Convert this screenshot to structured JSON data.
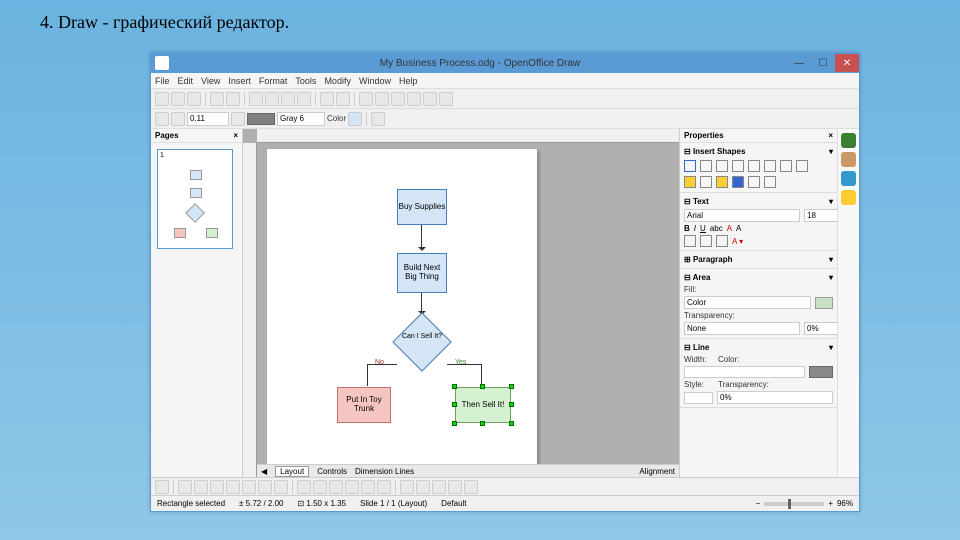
{
  "caption": "4. Draw - графический редактор.",
  "window": {
    "title": "My Business Process.odg - OpenOffice Draw"
  },
  "menu": [
    "File",
    "Edit",
    "View",
    "Insert",
    "Format",
    "Tools",
    "Modify",
    "Window",
    "Help"
  ],
  "toolbar2": {
    "line_width": "0.11",
    "line_style": "Gray 6",
    "color_label": "Color"
  },
  "pages_panel": {
    "title": "Pages",
    "page_num": "1"
  },
  "flowchart": {
    "box1": "Buy\nSupplies",
    "box2": "Build\nNext Big\nThing",
    "diamond": "Can I\nSell It?",
    "box_no": "Put In\nToy Trunk",
    "box_yes": "Then Sell It!",
    "edge_no": "No",
    "edge_yes": "Yes"
  },
  "tabs": {
    "layout": "Layout",
    "controls": "Controls",
    "dim": "Dimension Lines",
    "align": "Alignment"
  },
  "properties": {
    "title": "Properties",
    "insert_shapes": "Insert Shapes",
    "text": "Text",
    "font": "Arial",
    "size": "18",
    "bold": "B",
    "italic": "I",
    "under": "U",
    "paragraph": "Paragraph",
    "area": "Area",
    "fill": "Fill:",
    "fill_val": "Color",
    "transparency": "Transparency:",
    "trans_style": "None",
    "trans_val": "0%",
    "line": "Line",
    "width": "Width:",
    "color": "Color:",
    "style": "Style:",
    "line_trans": "Transparency:",
    "line_trans_val": "0%"
  },
  "status": {
    "sel": "Rectangle selected",
    "pos": "5.72 / 2.00",
    "size": "1.50 x 1.35",
    "slide": "Slide 1 / 1 (Layout)",
    "default": "Default",
    "zoom": "96%"
  }
}
